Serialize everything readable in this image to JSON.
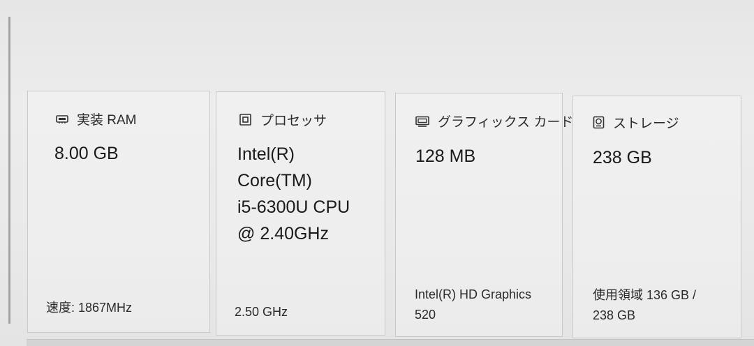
{
  "cards": [
    {
      "label": "実装 RAM",
      "icon": "ram-icon",
      "value_lines": [
        "8.00 GB"
      ],
      "footer_lines": [
        "速度: 1867MHz"
      ]
    },
    {
      "label": "プロセッサ",
      "icon": "processor-icon",
      "value_lines": [
        "Intel(R)",
        "Core(TM)",
        "i5-6300U CPU",
        "@ 2.40GHz"
      ],
      "footer_lines": [
        "2.50 GHz"
      ]
    },
    {
      "label": "グラフィックス カード",
      "icon": "graphics-card-icon",
      "value_lines": [
        "128 MB"
      ],
      "footer_lines": [
        "Intel(R) HD Graphics",
        "520"
      ]
    },
    {
      "label": "ストレージ",
      "icon": "storage-icon",
      "value_lines": [
        "238 GB"
      ],
      "footer_lines": [
        "使用領域 136 GB /",
        "238 GB"
      ]
    }
  ]
}
